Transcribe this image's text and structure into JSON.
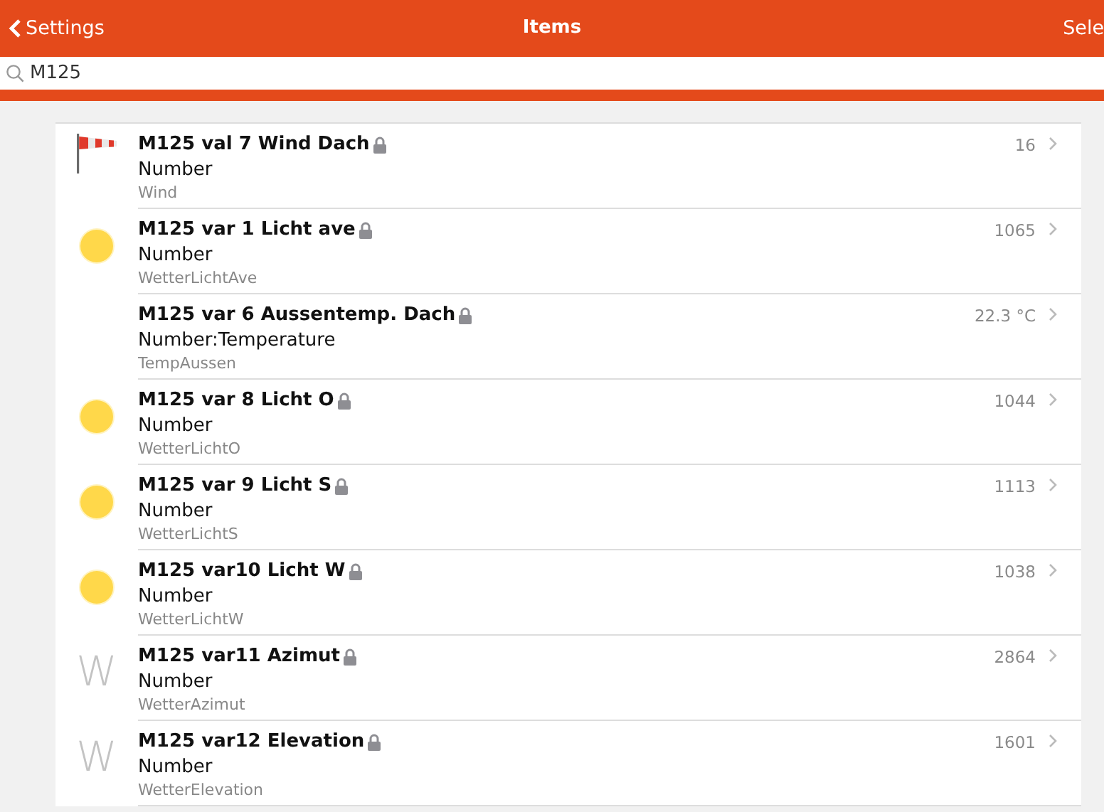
{
  "header": {
    "back_label": "Settings",
    "title": "Items",
    "action_label": "Sele"
  },
  "search": {
    "value": "M125"
  },
  "items": [
    {
      "icon": {
        "kind": "windsock"
      },
      "label": "M125 val 7 Wind Dach",
      "locked": true,
      "type": "Number",
      "name": "Wind",
      "state": "16"
    },
    {
      "icon": {
        "kind": "sun"
      },
      "label": "M125 var 1 Licht ave",
      "locked": true,
      "type": "Number",
      "name": "WetterLichtAve",
      "state": "1065"
    },
    {
      "icon": {
        "kind": "none"
      },
      "label": "M125 var 6 Aussentemp. Dach",
      "locked": true,
      "type": "Number:Temperature",
      "name": "TempAussen",
      "state": "22.3 °C"
    },
    {
      "icon": {
        "kind": "sun"
      },
      "label": "M125 var 8 Licht O",
      "locked": true,
      "type": "Number",
      "name": "WetterLichtO",
      "state": "1044"
    },
    {
      "icon": {
        "kind": "sun"
      },
      "label": "M125 var 9 Licht S",
      "locked": true,
      "type": "Number",
      "name": "WetterLichtS",
      "state": "1113"
    },
    {
      "icon": {
        "kind": "sun"
      },
      "label": "M125 var10 Licht W",
      "locked": true,
      "type": "Number",
      "name": "WetterLichtW",
      "state": "1038"
    },
    {
      "icon": {
        "kind": "letter",
        "text": "W"
      },
      "label": "M125 var11 Azimut",
      "locked": true,
      "type": "Number",
      "name": "WetterAzimut",
      "state": "2864"
    },
    {
      "icon": {
        "kind": "letter",
        "text": "W"
      },
      "label": "M125 var12 Elevation",
      "locked": true,
      "type": "Number",
      "name": "WetterElevation",
      "state": "1601"
    }
  ]
}
